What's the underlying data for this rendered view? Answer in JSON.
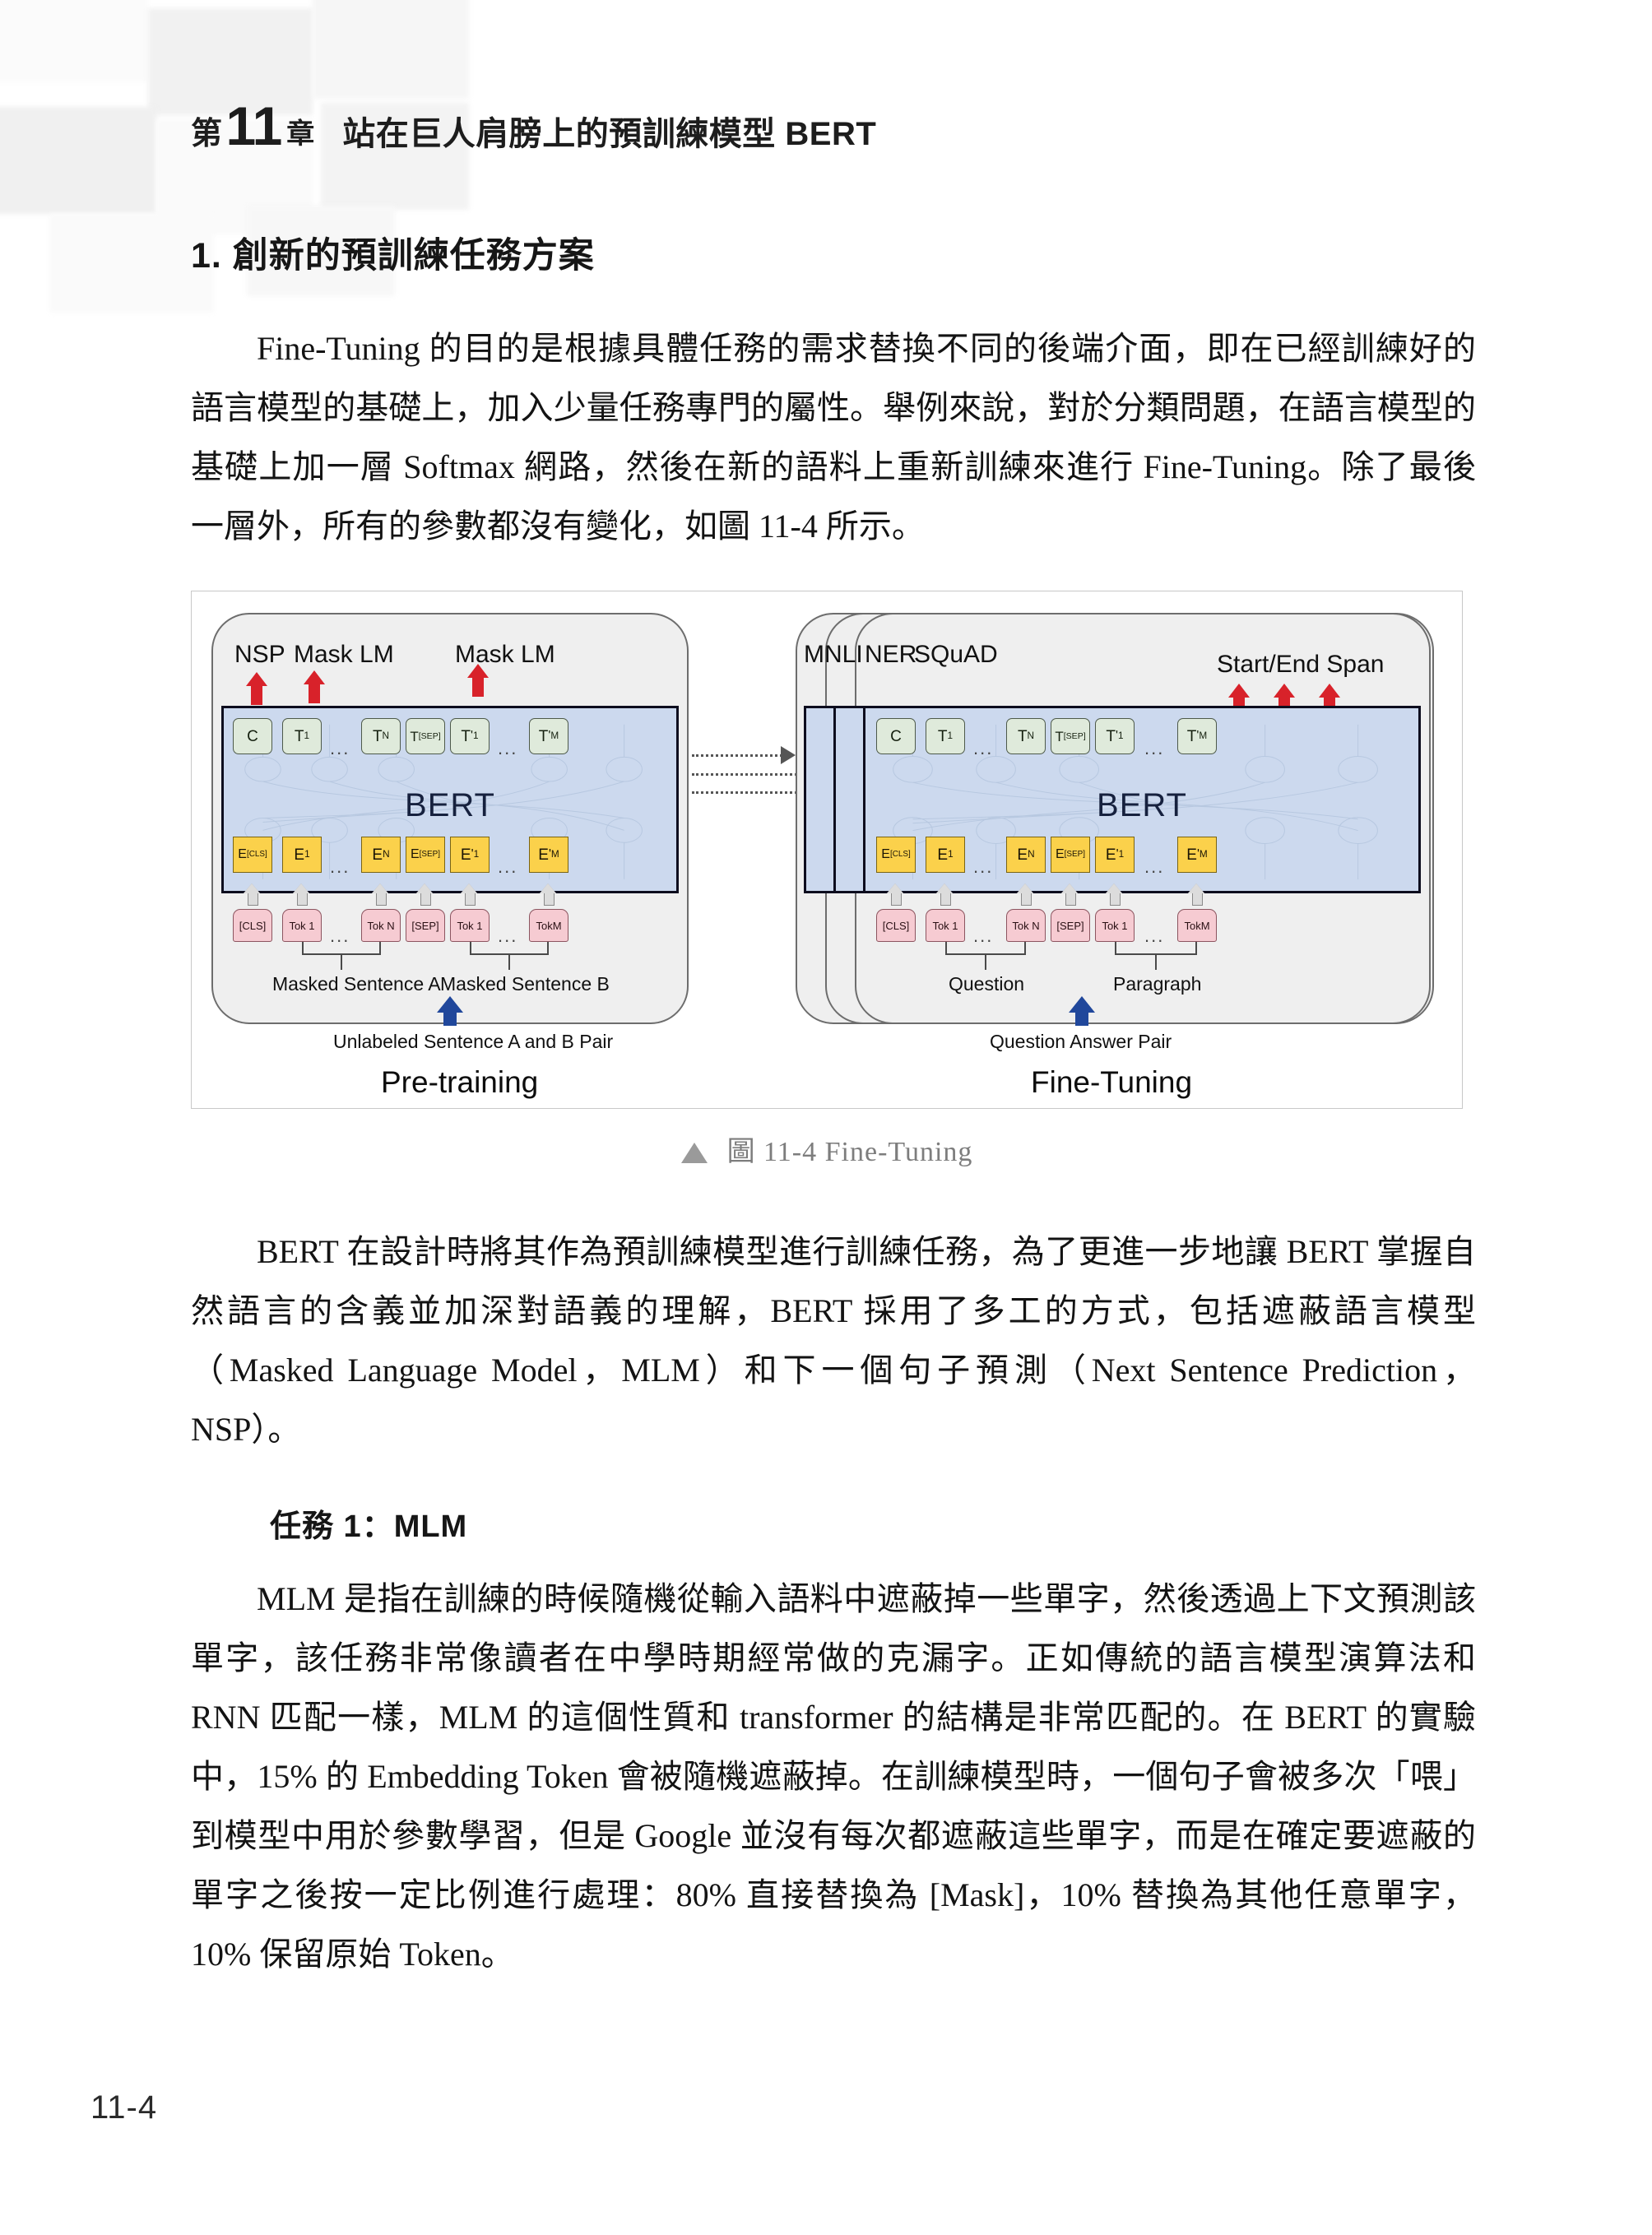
{
  "page": {
    "folio": "11-4"
  },
  "running_head": {
    "prefix": "第",
    "chapter_number": "11",
    "unit": "章",
    "title": "站在巨人肩膀上的預訓練模型 BERT"
  },
  "section": {
    "heading": "1. 創新的預訓練任務方案",
    "paragraph_1": "Fine-Tuning 的目的是根據具體任務的需求替換不同的後端介面，即在已經訓練好的語言模型的基礎上，加入少量任務專門的屬性。舉例來說，對於分類問題，在語言模型的基礎上加一層 Softmax 網路，然後在新的語料上重新訓練來進行 Fine-Tuning。除了最後一層外，所有的參數都沒有變化，如圖 11-4 所示。",
    "paragraph_2": "BERT 在設計時將其作為預訓練模型進行訓練任務，為了更進一步地讓 BERT 掌握自然語言的含義並加深對語義的理解，BERT 採用了多工的方式，包括遮蔽語言模型（Masked Language Model，MLM）和下一個句子預測（Next Sentence Prediction，NSP）。",
    "sub_heading": "任務 1：MLM",
    "paragraph_3": "MLM 是指在訓練的時候隨機從輸入語料中遮蔽掉一些單字，然後透過上下文預測該單字，該任務非常像讀者在中學時期經常做的克漏字。正如傳統的語言模型演算法和 RNN 匹配一樣，MLM 的這個性質和 transformer 的結構是非常匹配的。在 BERT 的實驗中，15% 的 Embedding Token 會被隨機遮蔽掉。在訓練模型時，一個句子會被多次「喂」到模型中用於參數學習，但是 Google 並沒有每次都遮蔽這些單字，而是在確定要遮蔽的單字之後按一定比例進行處理：80% 直接替換為 [Mask]，10% 替換為其他任意單字，10% 保留原始 Token。"
  },
  "figure": {
    "caption_marker": "▲",
    "caption_text": "圖 11-4  Fine-Tuning",
    "pretraining": {
      "panel_caption": "Pre-training",
      "output_labels": [
        "NSP",
        "Mask LM",
        "Mask LM"
      ],
      "bert_label": "BERT",
      "t_cells": [
        "C",
        "T1",
        "TN",
        "T[SEP]",
        "T1'",
        "TM'"
      ],
      "e_cells": [
        "E[CLS]",
        "E1",
        "EN",
        "E[SEP]",
        "E1'",
        "EM'"
      ],
      "tok_cells": [
        "[CLS]",
        "Tok 1",
        "Tok N",
        "[SEP]",
        "Tok 1",
        "TokM"
      ],
      "ellipsis": "...",
      "sentence_a_label": "Masked Sentence A",
      "sentence_b_label": "Masked Sentence B",
      "input_label": "Unlabeled Sentence A and B Pair"
    },
    "finetuning": {
      "panel_caption": "Fine-Tuning",
      "task_labels": [
        "MNLI",
        "NER",
        "SQuAD"
      ],
      "output_label": "Start/End Span",
      "bert_label": "BERT",
      "t_cells": [
        "C",
        "T1",
        "TN",
        "T[SEP]",
        "T1'",
        "TM'"
      ],
      "e_cells": [
        "E[CLS]",
        "E1",
        "EN",
        "E[SEP]",
        "E1'",
        "EM'"
      ],
      "tok_cells": [
        "[CLS]",
        "Tok 1",
        "Tok N",
        "[SEP]",
        "Tok 1",
        "TokM"
      ],
      "ellipsis": "...",
      "question_label": "Question",
      "paragraph_label": "Paragraph",
      "input_label": "Question Answer Pair"
    },
    "colors": {
      "panel_fill": "#efefef",
      "bert_core_fill": "#ccd9ee",
      "t_cell_fill": "#dfeadb",
      "e_cell_fill": "#fbd14b",
      "tok_cell_fill": "#f6cbd2",
      "red_arrow": "#d8222a",
      "blue_arrow": "#20479b",
      "gray_arrow": "#dcdcdc"
    }
  }
}
